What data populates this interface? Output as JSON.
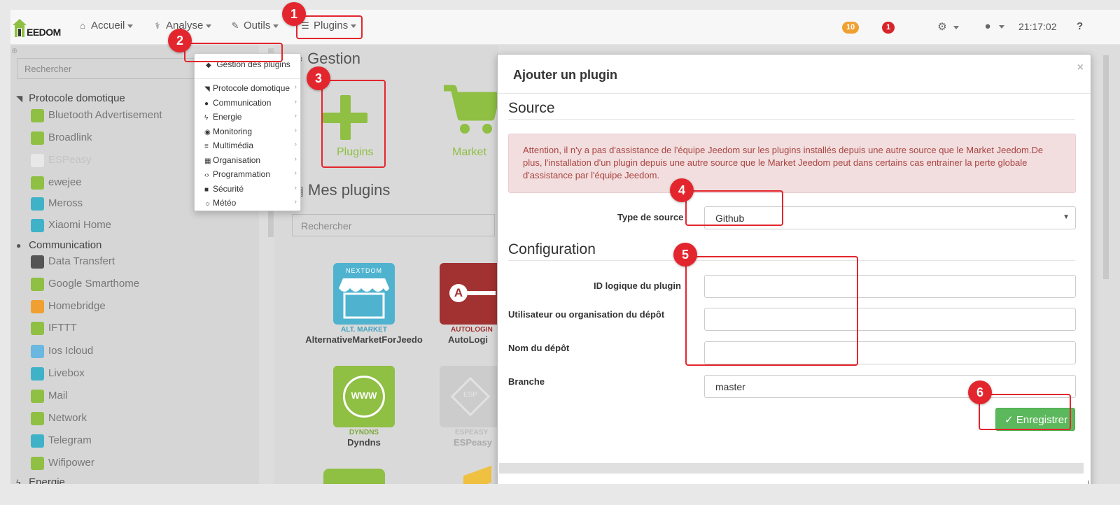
{
  "colors": {
    "accent": "#8fbf43",
    "badge_orange": "#f0a030",
    "badge_red": "#d9232a",
    "annotation_red": "#e3262d",
    "alert_bg": "#f2dede",
    "alert_text": "#a94442",
    "save_green": "#5cb85c"
  },
  "navbar": {
    "brand": "EEDOM",
    "items": [
      {
        "label": "Accueil",
        "icon": "home-icon"
      },
      {
        "label": "Analyse",
        "icon": "stethoscope-icon"
      },
      {
        "label": "Outils",
        "icon": "wrench-icon"
      },
      {
        "label": "Plugins",
        "icon": "tasks-icon"
      }
    ],
    "badge_warnings": "10",
    "badge_alerts": "1",
    "clock": "21:17:02",
    "settings_icon": "cogs-icon",
    "user_icon": "user-icon",
    "help_icon": "question-circle-icon"
  },
  "sidebar": {
    "search_placeholder": "Rechercher",
    "categories": [
      {
        "label": "Protocole domotique",
        "icon": "rss-icon",
        "items": [
          "Bluetooth Advertisement",
          "Broadlink",
          "ESPeasy",
          "ewejee",
          "Meross",
          "Xiaomi Home"
        ]
      },
      {
        "label": "Communication",
        "icon": "comment-icon",
        "items": [
          "Data Transfert",
          "Google Smarthome",
          "Homebridge",
          "IFTTT",
          "Ios Icloud",
          "Livebox",
          "Mail",
          "Network",
          "Telegram",
          "Wifipower"
        ]
      },
      {
        "label": "Energie",
        "icon": "bolt-icon",
        "items": []
      }
    ]
  },
  "plugins_menu": {
    "manage_label": "Gestion des plugins",
    "items": [
      "Protocole domotique",
      "Communication",
      "Energie",
      "Monitoring",
      "Multimédia",
      "Organisation",
      "Programmation",
      "Sécurité",
      "Météo"
    ]
  },
  "content": {
    "gestion_title": "Gestion",
    "add_tile_label": "Plugins",
    "market_tile_label": "Market",
    "mes_plugins_title": "Mes plugins",
    "search_placeholder": "Rechercher",
    "cards": [
      {
        "tag": "ALT. MARKET",
        "name": "AlternativeMarketForJeedo",
        "logo_text": "NEXTDOM"
      },
      {
        "tag": "AUTOLOGIN",
        "name": "AutoLogi",
        "logo_text": "A"
      },
      {
        "tag": "DYNDNS",
        "name": "Dyndns",
        "logo_text": "WWW"
      },
      {
        "tag": "ESPEASY",
        "name": "ESPeasy",
        "logo_text": "ESP"
      }
    ]
  },
  "modal": {
    "title": "Ajouter un plugin",
    "close": "×",
    "source_title": "Source",
    "alert_text": "Attention, il n'y a pas d'assistance de l'équipe Jeedom sur les plugins installés depuis une autre source que le Market Jeedom.De plus, l'installation d'un plugin depuis une autre source que le Market Jeedom peut dans certains cas entrainer la perte globale d'assistance par l'équipe Jeedom.",
    "type_label": "Type de source",
    "type_value": "Github",
    "config_title": "Configuration",
    "fields": [
      {
        "label": "ID logique du plugin",
        "value": ""
      },
      {
        "label": "Utilisateur ou organisation du dépôt",
        "value": ""
      },
      {
        "label": "Nom du dépôt",
        "value": ""
      },
      {
        "label": "Branche",
        "value": "master"
      }
    ],
    "save_label": "Enregistrer"
  },
  "annotations": [
    "1",
    "2",
    "3",
    "4",
    "5",
    "6"
  ]
}
